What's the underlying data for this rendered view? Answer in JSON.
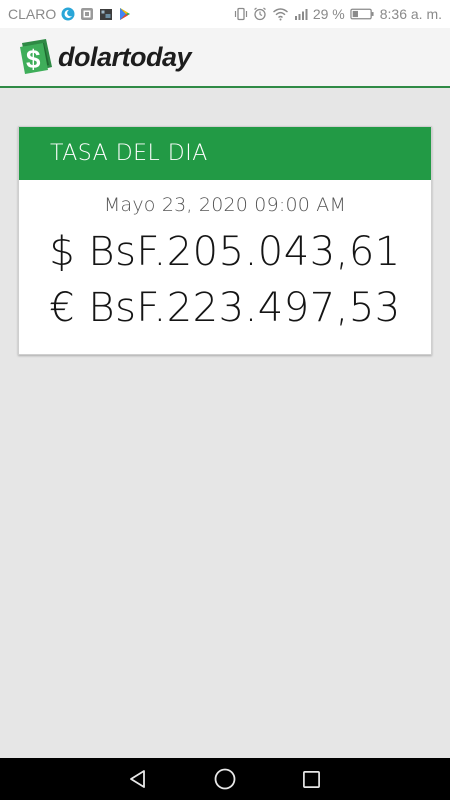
{
  "status_bar": {
    "carrier": "CLARO",
    "battery_percent": "29 %",
    "time": "8:36 a. m."
  },
  "header": {
    "logo_text": "dolartoday",
    "logo_icon": "dollar-sign-icon",
    "accent_color": "#229a45"
  },
  "rate_card": {
    "title": "TASA DEL DIA",
    "date": "Mayo 23, 2020 09:00 AM",
    "usd_rate": "$ BsF.205.043,61",
    "eur_rate": "€ BsF.223.497,53"
  },
  "nav": {
    "back_icon": "back-triangle-icon",
    "home_icon": "home-circle-icon",
    "recents_icon": "recents-square-icon"
  }
}
